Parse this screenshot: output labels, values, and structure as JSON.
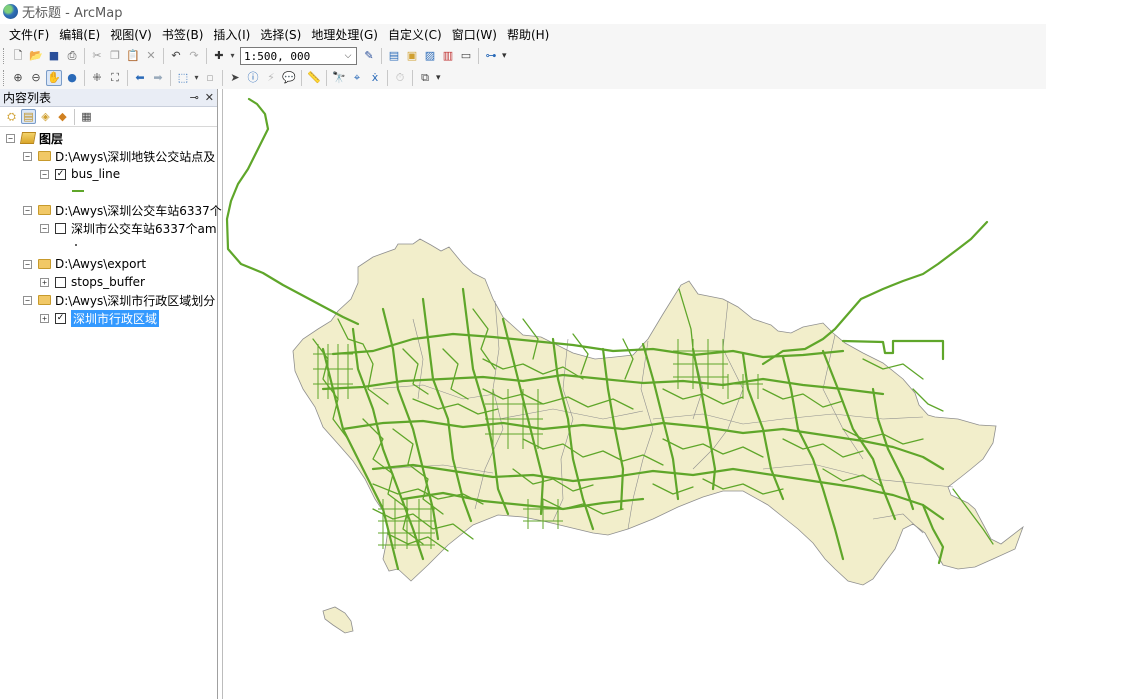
{
  "window": {
    "title": "无标题 - ArcMap"
  },
  "menubar": [
    "文件(F)",
    "编辑(E)",
    "视图(V)",
    "书签(B)",
    "插入(I)",
    "选择(S)",
    "地理处理(G)",
    "自定义(C)",
    "窗口(W)",
    "帮助(H)"
  ],
  "toolbar": {
    "scale_value": "1:500, 000"
  },
  "toc": {
    "title": "内容列表",
    "root_label": "图层",
    "groups": [
      {
        "path": "D:\\Awys\\深圳地铁公交站点及",
        "layer": "bus_line",
        "checked": true
      },
      {
        "path": "D:\\Awys\\深圳公交车站6337个",
        "layer": "深圳市公交车站6337个am",
        "checked": false
      },
      {
        "path": "D:\\Awys\\export",
        "layer": "stops_buffer",
        "checked": false
      },
      {
        "path": "D:\\Awys\\深圳市行政区域划分",
        "layer": "深圳市行政区域",
        "checked": true
      }
    ]
  },
  "colors": {
    "district_fill": "#f2eecb",
    "district_stroke": "#8f8f8f",
    "bus_line": "#5fa62a",
    "selection": "#3399ff"
  }
}
